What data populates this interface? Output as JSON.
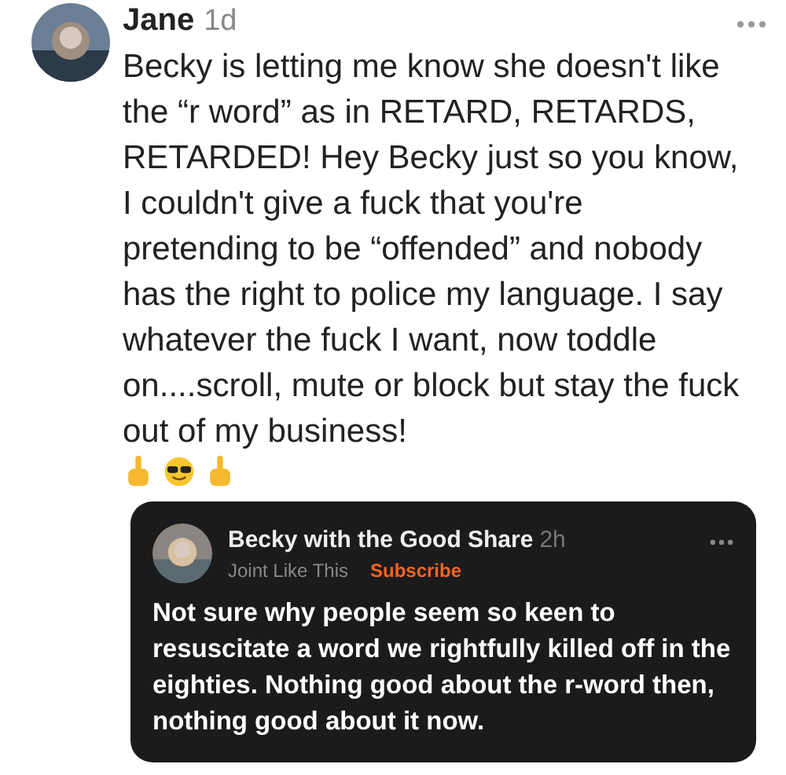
{
  "post": {
    "author": "Jane",
    "time": "1d",
    "body": "Becky is letting me know she doesn't like the “r word” as in RETARD, RETARDS, RETARDED! Hey Becky just so you know, I couldn't give a fuck that you're pretending to be “offended” and nobody has the right to police my language. I say whatever the fuck I want, now toddle on....scroll, mute or block but stay the fuck out of my business!",
    "quoted": {
      "author": "Becky with the Good Share",
      "time": "2h",
      "publication": "Joint Like This",
      "subscribe": "Subscribe",
      "body": "Not sure why people seem so keen to resuscitate a word we rightfully killed off in the eighties. Nothing good about the r-word then, nothing good about it now."
    }
  }
}
